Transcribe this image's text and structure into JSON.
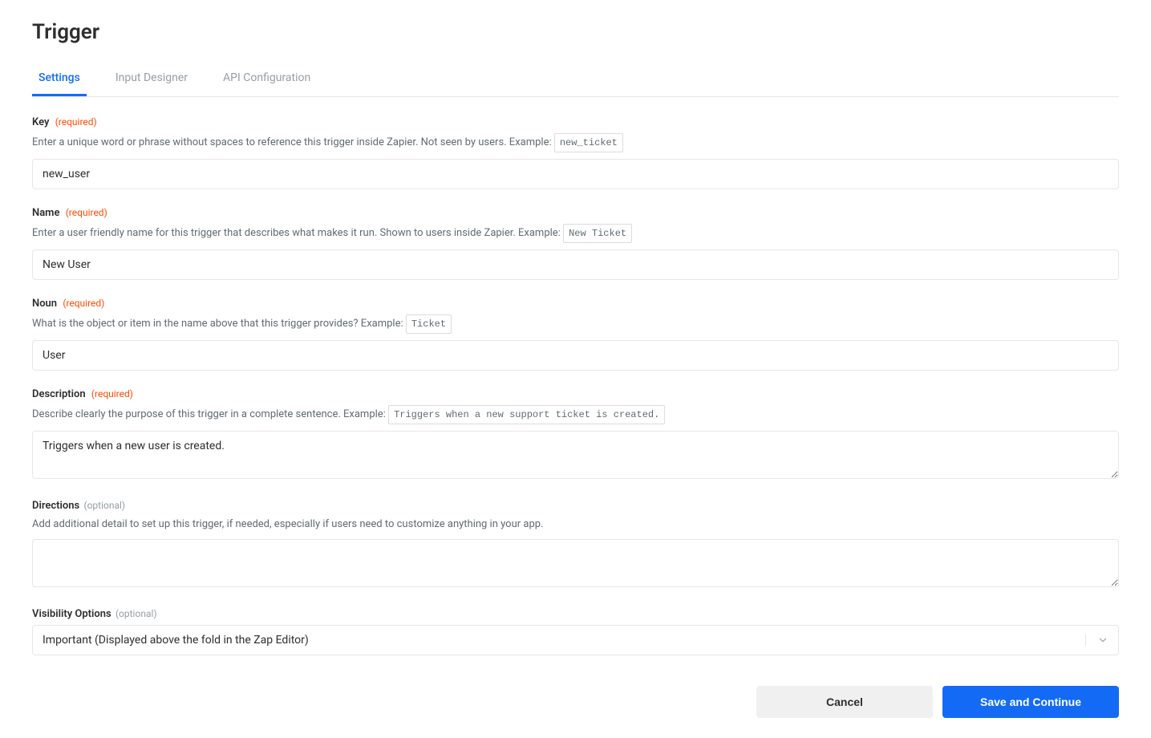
{
  "page": {
    "title": "Trigger"
  },
  "tabs": {
    "settings": "Settings",
    "inputDesigner": "Input Designer",
    "apiConfiguration": "API Configuration"
  },
  "labels": {
    "required": "(required)",
    "optional": "(optional)"
  },
  "fields": {
    "key": {
      "label": "Key",
      "help": "Enter a unique word or phrase without spaces to reference this trigger inside Zapier. Not seen by users. Example:",
      "example": "new_ticket",
      "value": "new_user"
    },
    "name": {
      "label": "Name",
      "help": "Enter a user friendly name for this trigger that describes what makes it run. Shown to users inside Zapier. Example:",
      "example": "New Ticket",
      "value": "New User"
    },
    "noun": {
      "label": "Noun",
      "help": "What is the object or item in the name above that this trigger provides? Example:",
      "example": "Ticket",
      "value": "User"
    },
    "description": {
      "label": "Description",
      "help": "Describe clearly the purpose of this trigger in a complete sentence. Example:",
      "example": "Triggers when a new support ticket is created.",
      "value": "Triggers when a new user is created."
    },
    "directions": {
      "label": "Directions",
      "help": "Add additional detail to set up this trigger, if needed, especially if users need to customize anything in your app.",
      "value": ""
    },
    "visibility": {
      "label": "Visibility Options",
      "value": "Important (Displayed above the fold in the Zap Editor)"
    }
  },
  "buttons": {
    "cancel": "Cancel",
    "save": "Save and Continue"
  }
}
